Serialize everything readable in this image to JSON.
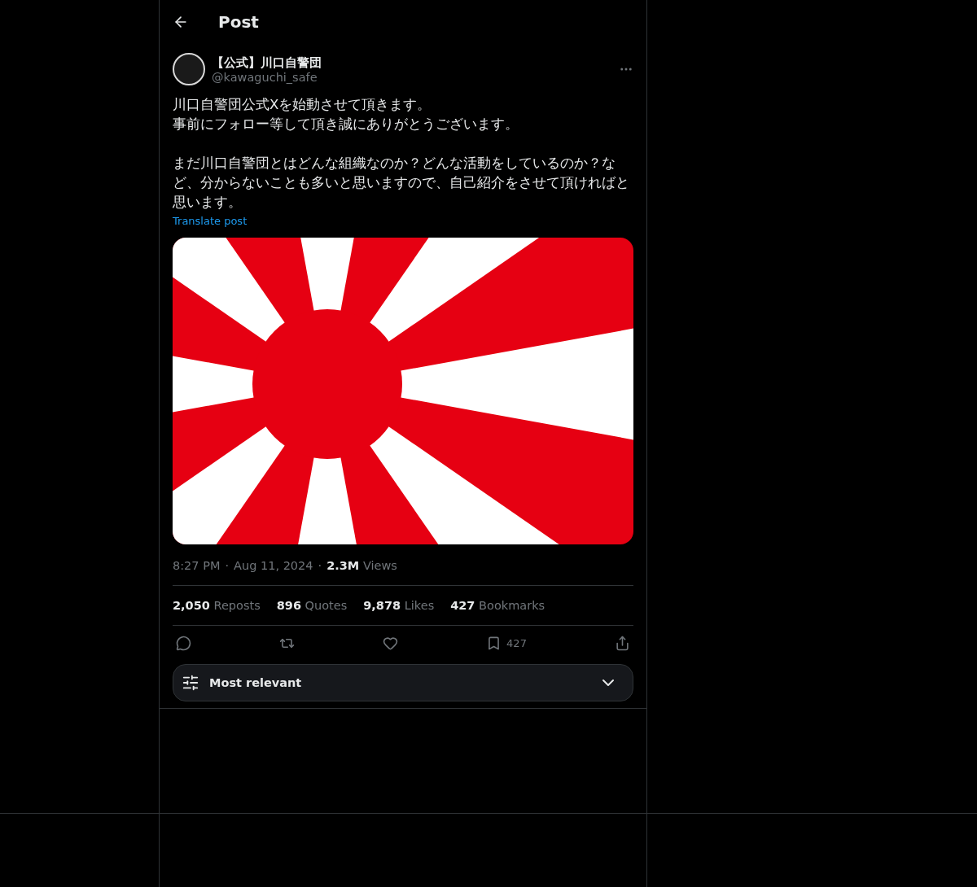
{
  "header": {
    "title": "Post"
  },
  "post": {
    "display_name": "【公式】川口自警団",
    "handle": "@kawaguchi_safe",
    "paragraphs": [
      [
        "川口自警団公式Xを始動させて頂きます。",
        "事前にフォロー等して頂き誠にありがとうございます。"
      ],
      [
        "まだ川口自警団とはどんな組織なのか？どんな活動をしているのか？など、分からないことも多いと思いますので、自己紹介をさせて頂ければと思います。"
      ]
    ],
    "translate": "Translate post",
    "media": {
      "kind": "picture"
    },
    "meta": [
      "8:27 PM",
      "·",
      "Aug 11, 2024",
      "·",
      "**2.3M** Views"
    ],
    "stats": [
      "**2,050** Reposts",
      "**896** Quotes",
      "**9,878** Likes",
      "**427** Bookmarks"
    ],
    "actions": [
      {
        "kind": "reply"
      },
      {
        "kind": "repost"
      },
      {
        "kind": "like"
      },
      {
        "kind": "bookmark",
        "count": "427"
      },
      {
        "kind": "share"
      }
    ]
  },
  "sort": {
    "label": "Most relevant"
  }
}
